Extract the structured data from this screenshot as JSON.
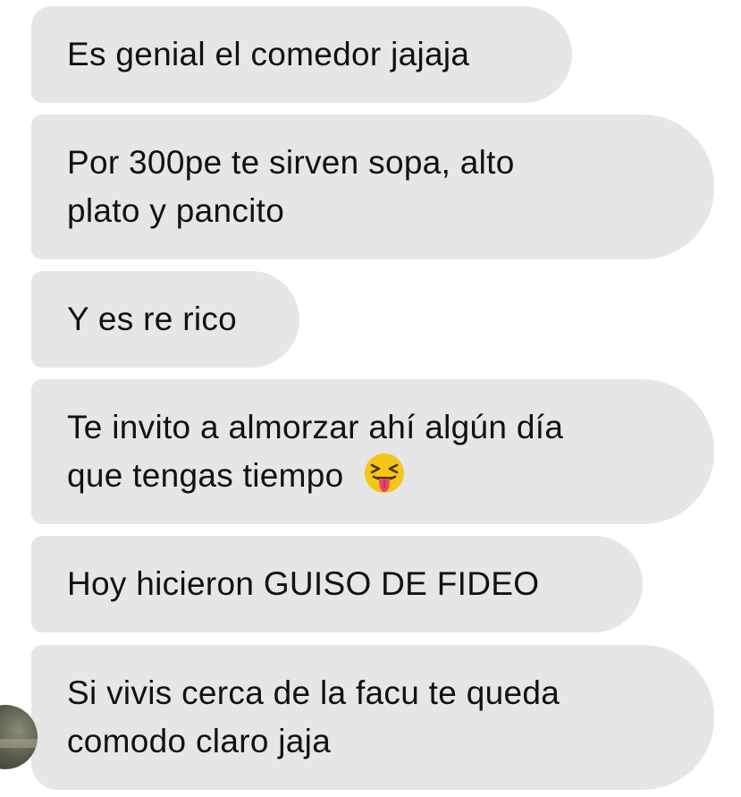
{
  "messages": [
    {
      "lines": [
        "Es genial el comedor jajaja"
      ]
    },
    {
      "lines": [
        "Por 300pe te sirven sopa, alto",
        "plato y pancito"
      ]
    },
    {
      "lines": [
        "Y es re rico"
      ]
    },
    {
      "lines": [
        "Te invito a almorzar ahí algún día",
        "que tengas tiempo"
      ],
      "emoji": "squinting-tongue-face"
    },
    {
      "lines": [
        "Hoy hicieron GUISO DE FIDEO"
      ]
    },
    {
      "lines": [
        "Si vivis cerca de la facu te queda",
        "comodo claro jaja"
      ]
    }
  ],
  "colors": {
    "bubble": "#e6e6e6",
    "text": "#111111",
    "emoji_face": "#f5c518",
    "emoji_tongue": "#e8446b"
  }
}
